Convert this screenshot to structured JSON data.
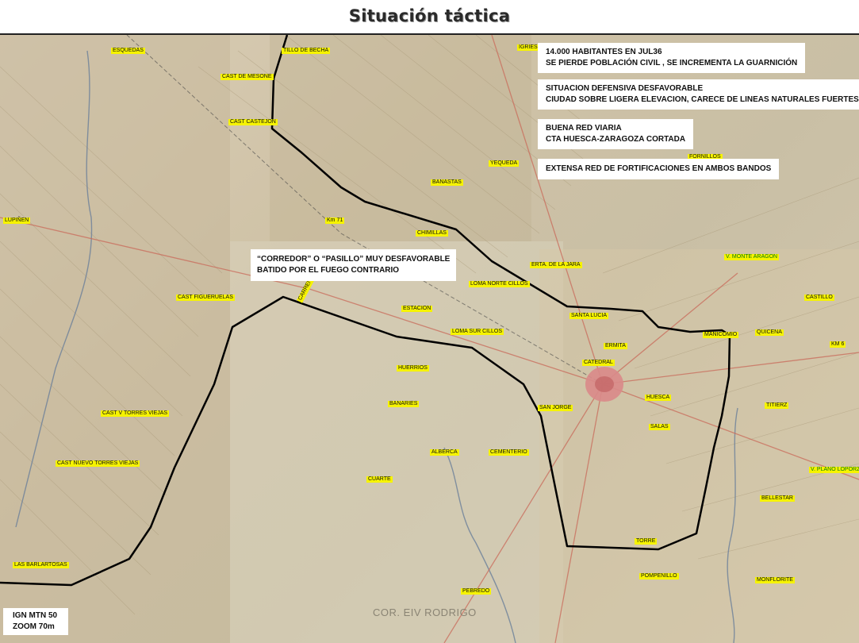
{
  "title": "Situación táctica",
  "info_boxes": [
    {
      "lines": [
        "14.000 HABITANTES EN JUL36",
        "SE PIERDE POBLACIÓN CIVIL , SE INCREMENTA LA GUARNICIÓN"
      ]
    },
    {
      "lines": [
        "SITUACION DEFENSIVA DESFAVORABLE",
        "CIUDAD SOBRE LIGERA ELEVACION, CARECE DE LINEAS NATURALES FUERTES"
      ]
    },
    {
      "lines": [
        "BUENA RED VIARIA",
        "CTA HUESCA-ZARAGOZA CORTADA"
      ]
    },
    {
      "lines": [
        "EXTENSA RED DE FORTIFICACIONES EN AMBOS BANDOS"
      ]
    }
  ],
  "corridor_box": {
    "lines": [
      "“CORREDOR” O “PASILLO” MUY DESFAVORABLE",
      "BATIDO POR EL FUEGO CONTRARIO"
    ]
  },
  "map_source": {
    "lines": [
      "IGN MTN 50",
      "ZOOM 70m"
    ]
  },
  "credit": "COR. EIV RODRIGO",
  "place_labels": [
    {
      "text": "ESQUEDAS",
      "style": "yellow"
    },
    {
      "text": "TILLO DE BECHA",
      "style": "yellow"
    },
    {
      "text": "CAST DE MESONE",
      "style": "yellow"
    },
    {
      "text": "CAST CASTEJON",
      "style": "yellow"
    },
    {
      "text": "IGRIES",
      "style": "yellow"
    },
    {
      "text": "YEQUEDA",
      "style": "yellow"
    },
    {
      "text": "FORNILLOS",
      "style": "yellow"
    },
    {
      "text": "BANASTAS",
      "style": "yellow"
    },
    {
      "text": "LUPIÑEN",
      "style": "yellow"
    },
    {
      "text": "Km 71",
      "style": "yellow"
    },
    {
      "text": "CHIMILLAS",
      "style": "yellow"
    },
    {
      "text": "ERTA. DE LA JARA",
      "style": "yellow"
    },
    {
      "text": "V. MONTE ARAGON",
      "style": "green"
    },
    {
      "text": "LOMA NORTE CILLOS",
      "style": "yellow"
    },
    {
      "text": "CAST FIGUERUELAS",
      "style": "yellow"
    },
    {
      "text": "CASTILLO",
      "style": "yellow"
    },
    {
      "text": "ESTACION",
      "style": "yellow"
    },
    {
      "text": "SANTA LUCIA",
      "style": "yellow"
    },
    {
      "text": "LOMA SUR CILLOS",
      "style": "yellow"
    },
    {
      "text": "MANICOMIO",
      "style": "yellow"
    },
    {
      "text": "QUICENA",
      "style": "yellow"
    },
    {
      "text": "KM 6",
      "style": "yellow"
    },
    {
      "text": "ERMITA",
      "style": "yellow"
    },
    {
      "text": "CATEDRAL",
      "style": "yellow"
    },
    {
      "text": "HUERRIOS",
      "style": "yellow"
    },
    {
      "text": "HUESCA",
      "style": "yellow"
    },
    {
      "text": "BANARIES",
      "style": "yellow"
    },
    {
      "text": "SAN JORGE",
      "style": "yellow"
    },
    {
      "text": "TITIERZ",
      "style": "yellow"
    },
    {
      "text": "CAST V TORRES VIEJAS",
      "style": "yellow"
    },
    {
      "text": "SALAS",
      "style": "yellow"
    },
    {
      "text": "ALBERCA",
      "style": "yellow"
    },
    {
      "text": "CEMENTERIO",
      "style": "yellow"
    },
    {
      "text": "CAST NUEVO TORRES VIEJAS",
      "style": "yellow"
    },
    {
      "text": "V. PLANO LOPORZANO",
      "style": "green"
    },
    {
      "text": "CUARTE",
      "style": "yellow"
    },
    {
      "text": "BELLESTAR",
      "style": "yellow"
    },
    {
      "text": "TORRE",
      "style": "yellow"
    },
    {
      "text": "LAS BARLARTOSAS",
      "style": "yellow"
    },
    {
      "text": "POMPENILLO",
      "style": "yellow"
    },
    {
      "text": "MONFLORITE",
      "style": "yellow"
    },
    {
      "text": "PEBREDO",
      "style": "yellow"
    },
    {
      "text": "CARRENOTAL",
      "style": "yellow"
    }
  ],
  "colors": {
    "label_fill": "#f6f300",
    "front_line": "#000000",
    "city": "#d9898a"
  }
}
